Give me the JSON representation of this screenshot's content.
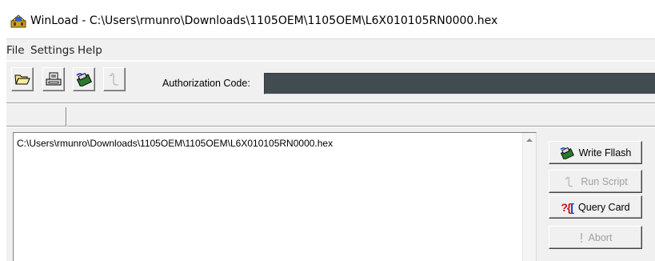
{
  "window": {
    "title": "WinLoad - C:\\Users\\rmunro\\Downloads\\1105OEM\\1105OEM\\L6X010105RN0000.hex",
    "icon": "winload-app-icon"
  },
  "menu": {
    "items": [
      "File",
      "Settings",
      "Help"
    ]
  },
  "toolbar": {
    "buttons": [
      "open-folder-icon",
      "print-icon",
      "write-flash-icon",
      "run-script-icon"
    ],
    "auth_label": "Authorization Code:",
    "auth_value": ""
  },
  "log": {
    "lines": [
      "C:\\Users\\rmunro\\Downloads\\1105OEM\\1105OEM\\L6X010105RN0000.hex"
    ]
  },
  "actions": {
    "write_flash": "Write Fllash",
    "run_script": "Run Script",
    "query_card": "Query Card",
    "abort": "Abort"
  },
  "colors": {
    "auth_field_bg": "#414b50",
    "chrome_bg": "#f0f0f0"
  }
}
